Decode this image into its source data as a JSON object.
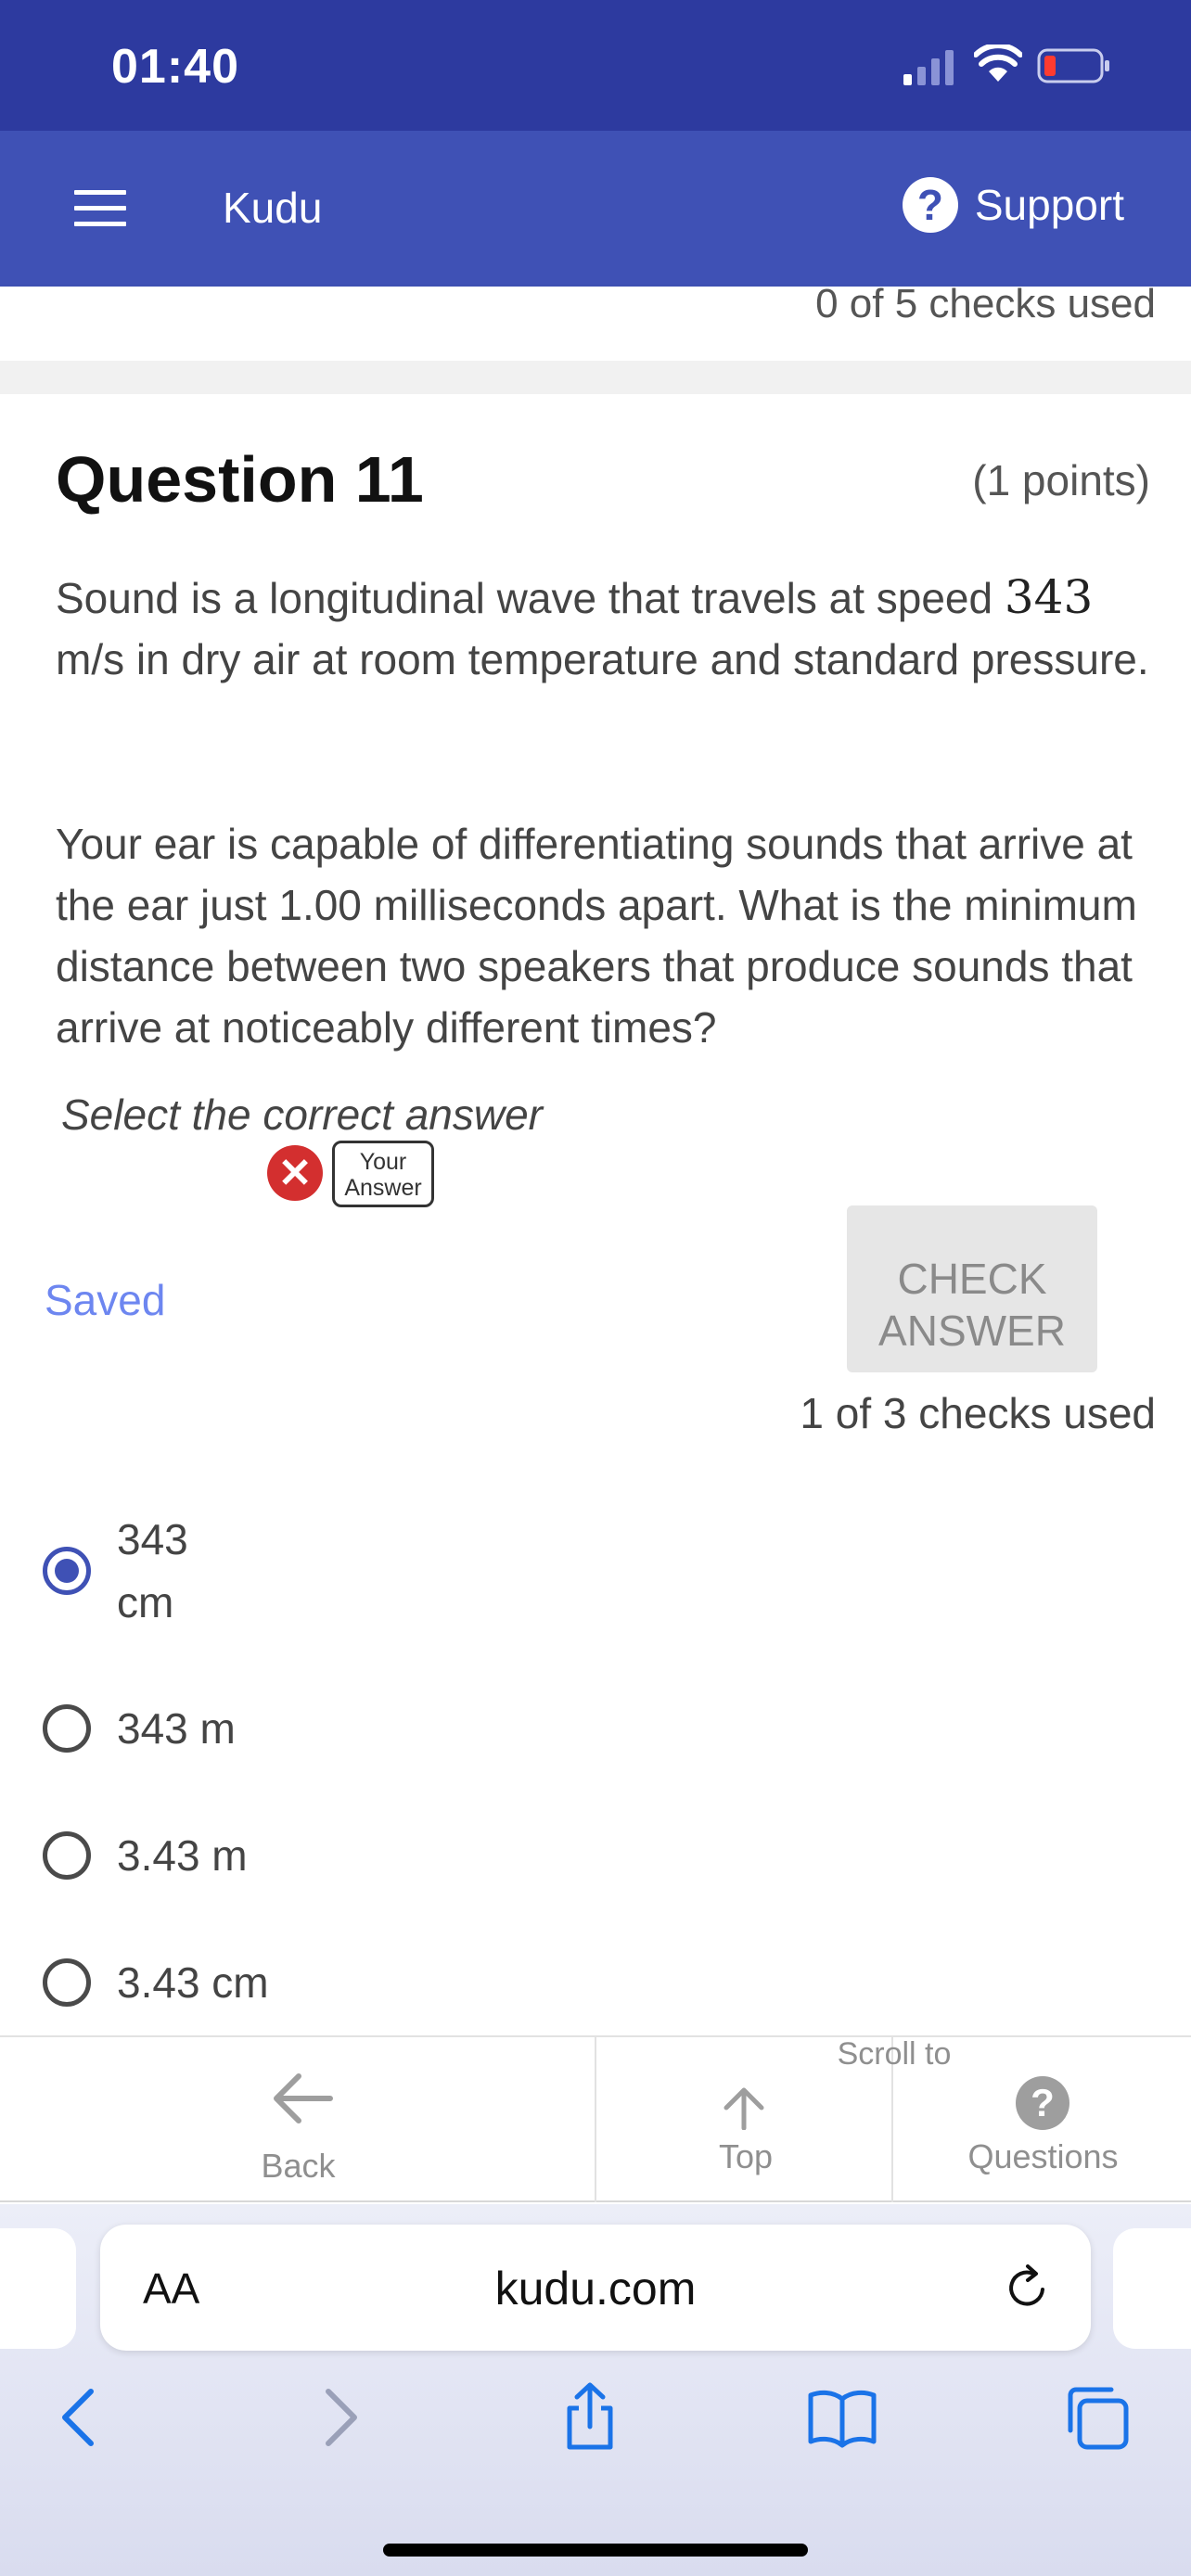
{
  "status_bar": {
    "time": "01:40"
  },
  "header": {
    "app_title": "Kudu",
    "support_label": "Support",
    "support_icon": "?"
  },
  "previous_card": {
    "checks_used": "0 of 5 checks used"
  },
  "question": {
    "title": "Question 11",
    "points": "(1 points)",
    "text1_before": "Sound is a longitudinal wave that travels at speed ",
    "text1_math": "343",
    "text1_after": " m/s in dry air at room temperature and standard pressure.",
    "text2": "Your ear is capable of differentiating sounds that arrive at the ear just 1.00 milliseconds apart. What is the minimum distance between two speakers that produce sounds that arrive at noticeably different times?",
    "instruction": "Select the correct answer",
    "saved_label": "Saved",
    "check_button_label": "CHECK ANSWER",
    "checks_used": "1 of 3 checks used",
    "wrong_icon": "✕",
    "your_answer_badge": "Your Answer",
    "options": [
      {
        "label": "343 cm",
        "selected": true
      },
      {
        "label": "343 m",
        "selected": false
      },
      {
        "label": "3.43 m",
        "selected": false
      },
      {
        "label": "3.43 cm",
        "selected": false
      }
    ]
  },
  "bottom_nav": {
    "back_label": "Back",
    "scroll_to_label": "Scroll to",
    "top_label": "Top",
    "questions_label": "Questions",
    "questions_icon": "?"
  },
  "browser": {
    "aa_label": "AA",
    "url": "kudu.com"
  },
  "colors": {
    "status_bar": "#2d3a9f",
    "header": "#3f51b5",
    "saved_text": "#6d86f0",
    "wrong": "#d32f2f",
    "ios_blue": "#1a73e8"
  }
}
